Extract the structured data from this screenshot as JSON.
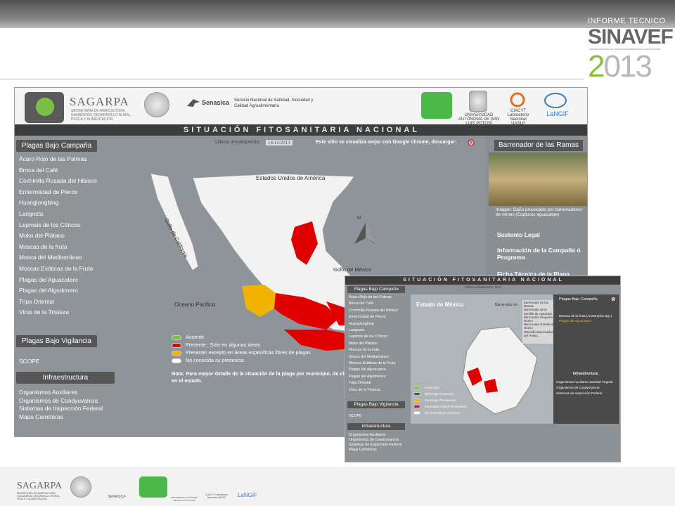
{
  "header": {
    "brand_line1": "INFORME TECNICO",
    "brand_line2": "SINAVEF",
    "brand_line3": "SISTEMA NACIONAL DE VIGILANCIA EPIDEMIOLÓGICA FITOSANITARIA",
    "brand_year": "2013"
  },
  "site": {
    "sagarpa": "SAGARPA",
    "sagarpa_sub": "SECRETARÍA DE AGRICULTURA, GANADERÍA, DESARROLLO RURAL, PESCA Y ALIMENTACIÓN",
    "senasica": "Senasica",
    "senasica_full": "Servicio Nacional de Sanidad, Inocuidad y Calidad Agroalimentaria",
    "uaslp": "UNIVERSIDAD AUTÓNOMA DE SAN LUIS POTOSÍ",
    "ciacyt": "CIACYT Laboratorio Nacional UASLP",
    "langif": "LaNGIF",
    "title": "SITUACIÓN FITOSANITARIA NACIONAL",
    "update_label": "Ultima actualización:",
    "update_value": "14/11/2013",
    "browser_note": "Este sitio se visualiza mejor con Google chrome, descargar:",
    "sidebar": {
      "campana_header": "Plagas Bajo Campaña",
      "campana_items": [
        "Ácaro Rojo de las Palmas",
        "Broca del Café",
        "Cochinilla Rosada del Hibisco",
        "Enfermedad de Pierce",
        "Huanglongbing",
        "Langosta",
        "Leprosis de los Cítricos",
        "Moko del Plátano",
        "Moscas de la fruta",
        "Mosca del Mediterráneo",
        "Moscas Exóticas de la Fruta",
        "Plagas del Aguacatero",
        "Plagas del Algodonero",
        "Trips Oriental",
        "Virus de la Tristeza"
      ],
      "vigilancia_header": "Plagas Bajo Vigilancia",
      "vigilancia_items": [
        "SCOPE"
      ],
      "infra_header": "Infraestructura",
      "infra_items": [
        "Organismos Auxiliares",
        "Organismos de Coadyuvancia",
        "Sistemas de Inspección Federal",
        "Mapa Carreteras"
      ]
    },
    "map": {
      "usa": "Estados Unidos de América",
      "gulf_california": "Golfo de California",
      "gulf_mexico": "Golfo de México",
      "pacific": "Oceano Pacifico",
      "north": "N"
    },
    "legend": [
      "Ausente",
      "Presente ; Solo en algunas áreas",
      "Presente; excepto en áreas especificas libres de plagas",
      "No conocida su presencia"
    ],
    "legend_colors": [
      "#7fbf3f",
      "#e00000",
      "#f0b400",
      "#ffffff"
    ],
    "note": "Nota: Para mayor detalle de la situación de la plaga por municipio, de click en el estado.",
    "right": {
      "header": "Barrenador de las Ramas",
      "caption": "Imagen: Daño provocado por barrenadores de ramas (Copturus aguacatae)",
      "links": [
        "Sustento Legal",
        "Información de la Campaña ó Programa",
        "Ficha Técnica de la Plaga"
      ]
    }
  },
  "inset": {
    "title": "SITUACIÓN FITOSANITARIA NACIONAL",
    "update": "Ultima actualización: 2012",
    "state": "Estado de México",
    "barr": "Barrenador de",
    "dropdown": [
      "Barrenador de las Ramas",
      "Barrenador de la Semilla de Aguacate",
      "Barrenador Pequeño del Hueso",
      "Barrenador Grande del Hueso",
      "Palomilla Barrenadora del Hueso"
    ],
    "overlay": {
      "header": "Plagas Bajo Campaña",
      "close": "⊗",
      "items": [
        "Moscas de la fruta (Anastrepha spp.)",
        "Plagas del Aguacatero"
      ],
      "infra_header": "Infraestructura",
      "infra_items": [
        "Organismos Auxiliares Sanidad Vegetal",
        "Organismos de Coadyuvancia",
        "Sistemas de Inspección Federal"
      ]
    },
    "sidebar": {
      "campana_header": "Plagas Bajo Campaña",
      "items": [
        "Ácaro Rojo de las Palmas",
        "Broca del Café",
        "Cochinilla Rosada del Hibisco",
        "Enfermedad de Pierce",
        "Huanglongbing",
        "Langosta",
        "Leprosis de los Cítricos",
        "Moko del Plátano",
        "Moscas de la fruta",
        "Mosca del Mediterráneo",
        "Moscas Exóticas de la Fruta",
        "Plagas del Aguacatero",
        "Plagas del Algodonero",
        "Trips Oriental",
        "Virus de la Tristeza"
      ],
      "vig_header": "Plagas Bajo Vigilancia",
      "vig_items": [
        "SCOPE"
      ],
      "infra_header": "Infraestructura",
      "infra_items": [
        "Organismos Auxiliares",
        "Organismos de Coadyuvancia",
        "Sistemas de Inspección Federal",
        "Mapa Carreteras"
      ]
    },
    "legend": [
      "Zona Libre",
      "Zona bajo Protección",
      "Zona bajo Prevalencia",
      "Zona Bajo Control Fitosanitario",
      "No conocida su presencia"
    ],
    "legend_colors": [
      "#7fbf3f",
      "#2e6b2e",
      "#f0b400",
      "#e00000",
      "#ffffff"
    ]
  },
  "footer": {
    "sagarpa": "SAGARPA",
    "sagarpa_sub": "SECRETARÍA DE AGRICULTURA, GANADERÍA, DESARROLLO RURAL, PESCA Y ALIMENTACIÓN",
    "senasica": "SENASICA",
    "uaslp": "UNIVERSIDAD AUTÓNOMA DE SAN LUIS POTOSÍ",
    "ciacyt": "CIACYT Laboratorio Nacional UASLP",
    "langif": "LaNGIF"
  }
}
